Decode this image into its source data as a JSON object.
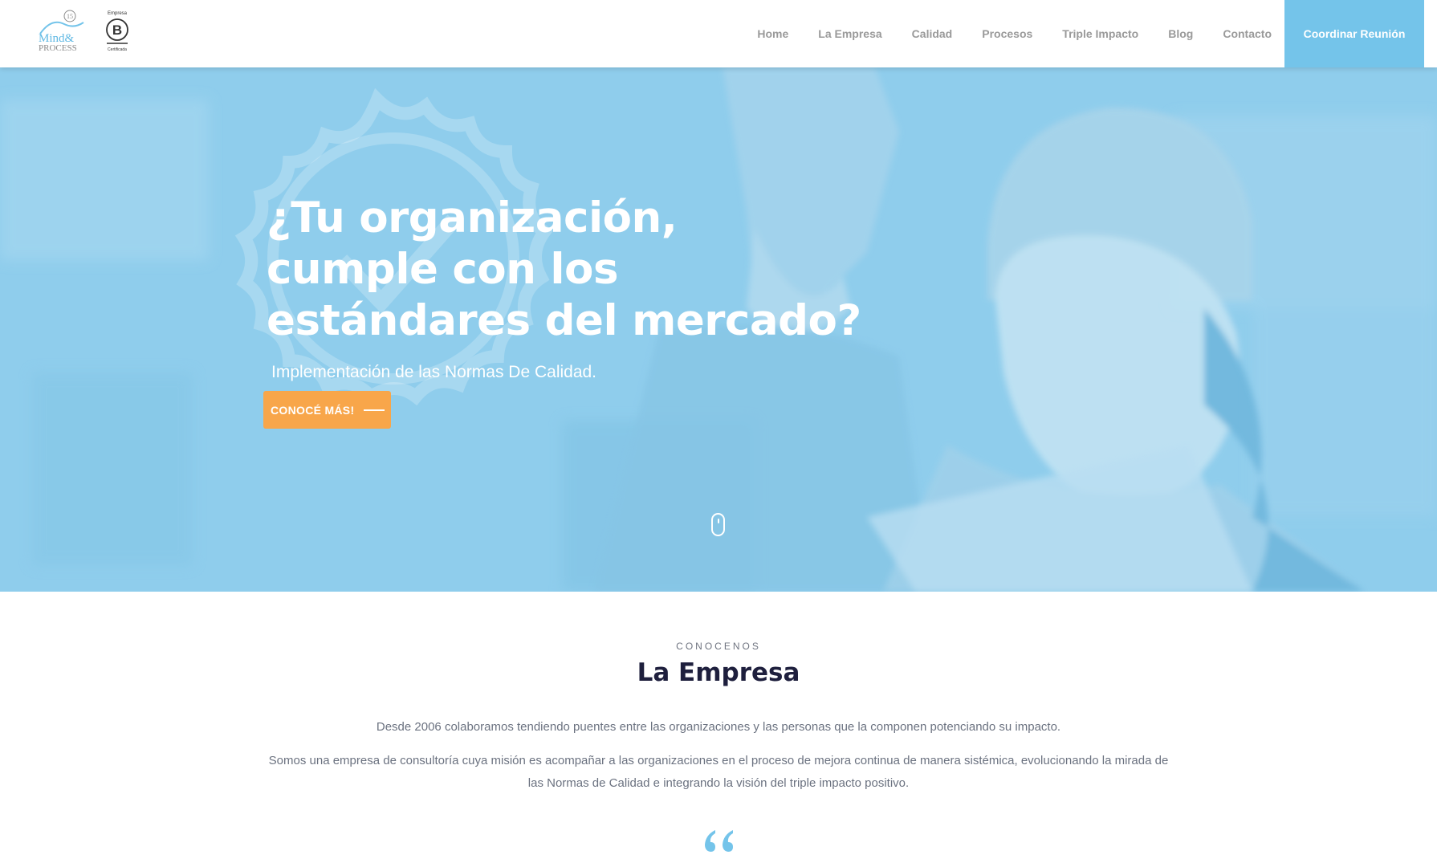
{
  "header": {
    "logo": {
      "brand_line1": "Mind&",
      "brand_line2": "PROCESS",
      "anniversary": "15",
      "bcorp_top": "Empresa",
      "bcorp_letter": "B",
      "bcorp_bottom": "Certificada"
    },
    "nav": [
      "Home",
      "La Empresa",
      "Calidad",
      "Procesos",
      "Triple Impacto",
      "Blog",
      "Contacto"
    ],
    "cta_label": "Coordinar Reunión"
  },
  "hero": {
    "title_lines": [
      "¿Tu organización,",
      "cumple con los",
      "estándares del mercado?"
    ],
    "subtitle": "Implementación de las Normas De Calidad.",
    "button_label": "CONOCÉ MÁS!",
    "scroll_icon": "mouse-scroll-icon"
  },
  "about": {
    "eyebrow": "CONOCENOS",
    "title": "La Empresa",
    "paragraph1": "Desde 2006 colaboramos tendiendo puentes entre las organizaciones y las personas que la componen potenciando su impacto.",
    "paragraph2": "Somos una empresa de consultoría cuya misión es acompañar a las organizaciones en el proceso de mejora continua de manera sistémica, evolucionando la mirada de las Normas de Calidad e integrando la visión del triple impacto positivo.",
    "quote_icon": "quote-icon"
  },
  "colors": {
    "accent_blue": "#74c4ea",
    "hero_overlay": "#8fcdec",
    "button_orange": "#f8a64a",
    "title_dark": "#1e1f3d",
    "body_text": "#6b7280",
    "nav_text": "#9a9a9a"
  }
}
